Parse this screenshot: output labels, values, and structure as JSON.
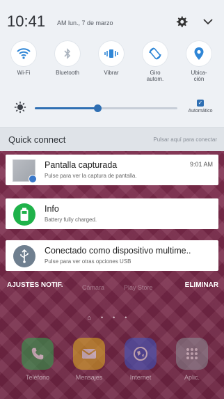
{
  "status": {
    "time": "10:41",
    "ampm": "AM",
    "date": "lun., 7 de marzo"
  },
  "quick_toggles": [
    {
      "label": "Wi-Fi",
      "icon": "wifi-icon",
      "active": true
    },
    {
      "label": "Bluetooth",
      "icon": "bluetooth-icon",
      "active": false
    },
    {
      "label": "Vibrar",
      "icon": "vibrate-icon",
      "active": true
    },
    {
      "label": "Giro\nautom.",
      "icon": "rotate-icon",
      "active": true
    },
    {
      "label": "Ubica-\nción",
      "icon": "location-icon",
      "active": true
    }
  ],
  "brightness": {
    "level": 0.44,
    "auto_label": "Automático",
    "auto_checked": true
  },
  "quick_connect": {
    "title": "Quick connect",
    "hint": "Pulsar aquí para conectar"
  },
  "notifications": [
    {
      "title": "Pantalla capturada",
      "text": "Pulse para ver la captura de pantalla.",
      "time": "9:01 AM"
    },
    {
      "title": "Info",
      "text": "Battery fully charged.",
      "time": ""
    },
    {
      "title": "Conectado como dispositivo multime..",
      "text": "Pulse para ver otras opciones USB",
      "time": ""
    }
  ],
  "actions": {
    "settings": "AJUSTES NOTIF.",
    "clear": "ELIMINAR"
  },
  "home_top_labels": [
    "Cámara",
    "Play Store"
  ],
  "dock": [
    {
      "label": "Teléfono",
      "color": "#2fa84f"
    },
    {
      "label": "Mensajes",
      "color": "#e0b020"
    },
    {
      "label": "Internet",
      "color": "#3b59c8"
    },
    {
      "label": "Aplic.",
      "color": "#8b8f96"
    }
  ],
  "colors": {
    "accent": "#2f6fb3",
    "shade_bg": "#eef1f5",
    "battery_green": "#1fb24a",
    "usb_gray": "#6f7f8f"
  }
}
